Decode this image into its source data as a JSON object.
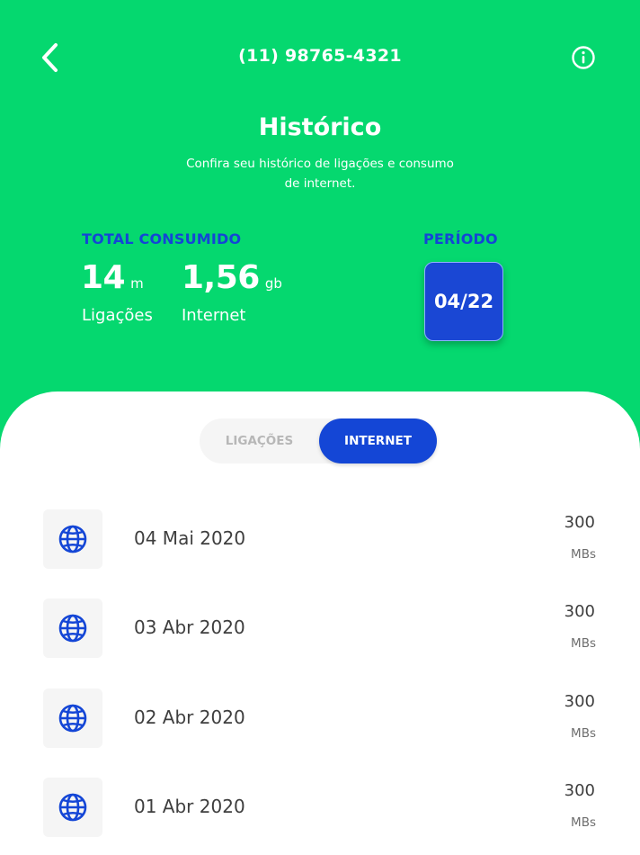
{
  "header": {
    "phone": "(11) 98765-4321",
    "title": "Histórico",
    "subtitle": "Confira seu histórico de ligações e consumo de internet."
  },
  "summary": {
    "total_label": "TOTAL CONSUMIDO",
    "calls": {
      "value": "14",
      "unit": "m",
      "label": "Ligações"
    },
    "internet": {
      "value": "1,56",
      "unit": "gb",
      "label": "Internet"
    },
    "period_label": "PERÍODO",
    "period_value": "04/22"
  },
  "tabs": {
    "calls": "LIGAÇÕES",
    "internet": "INTERNET",
    "active": "internet"
  },
  "entries": [
    {
      "date": "04 Mai 2020",
      "value": "300",
      "unit": "MBs",
      "icon": "globe-icon"
    },
    {
      "date": "03 Abr 2020",
      "value": "300",
      "unit": "MBs",
      "icon": "globe-icon"
    },
    {
      "date": "02 Abr 2020",
      "value": "300",
      "unit": "MBs",
      "icon": "globe-icon"
    },
    {
      "date": "01 Abr 2020",
      "value": "300",
      "unit": "MBs",
      "icon": "globe-icon"
    }
  ],
  "colors": {
    "brand_green": "#05D86F",
    "accent_blue": "#1446D6",
    "card_bg": "#F5F5F5",
    "text_dark": "#3E3E3E"
  }
}
